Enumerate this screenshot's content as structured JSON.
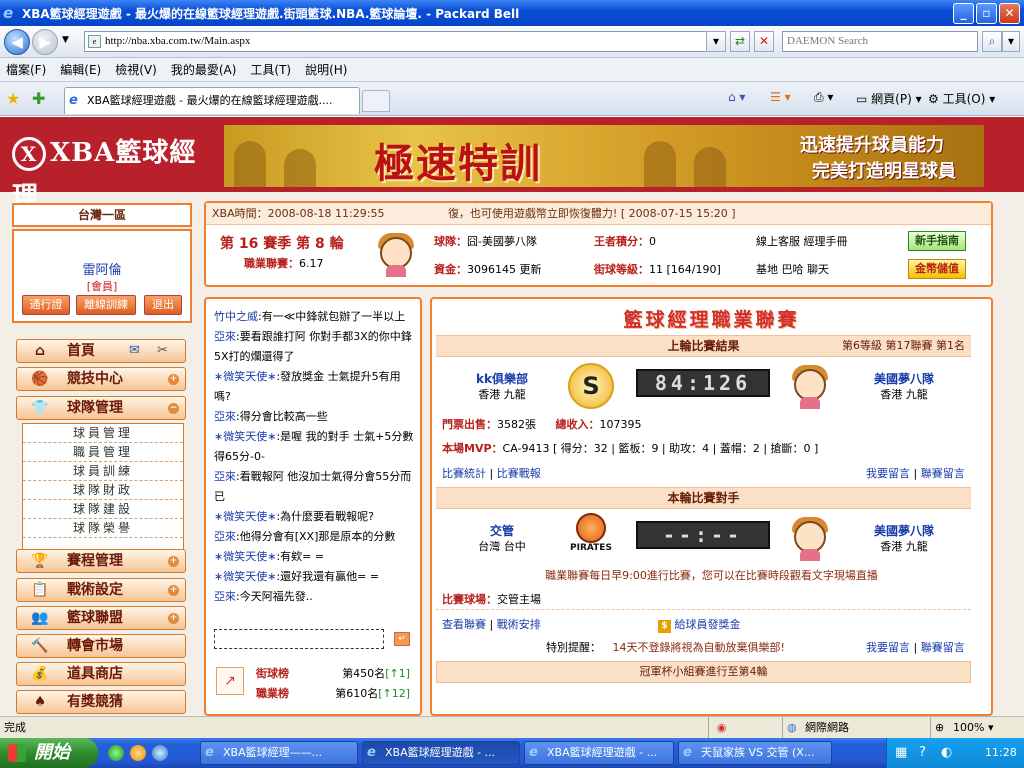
{
  "window": {
    "title": "XBA籃球經理遊戲 - 最火爆的在線籃球經理遊戲.街頭籃球.NBA.籃球論壇. - Packard Bell",
    "min": "_",
    "max": "▫",
    "close": "✕"
  },
  "address": {
    "url": "http://nba.xba.com.tw/Main.aspx",
    "search_placeholder": "DAEMON Search"
  },
  "menu": [
    "檔案(F)",
    "編輯(E)",
    "檢視(V)",
    "我的最愛(A)",
    "工具(T)",
    "說明(H)"
  ],
  "tab": {
    "label": "XBA籃球經理遊戲 - 最火爆的在線籃球經理遊戲....",
    "tools_page": "網頁(P)",
    "tools_tools": "工具(O)"
  },
  "banner": {
    "logo_text": "XBA籃球經理",
    "ad_main": "極速特訓",
    "ad_line1": "迅速提升球員能力",
    "ad_line2": "完美打造明星球員"
  },
  "sidebar": {
    "zone": "台灣一區",
    "user_name": "雷阿倫",
    "user_rank": "[會員]",
    "btn_pass": "通行證",
    "btn_train": "離線訓練",
    "btn_exit": "退出",
    "home": "首頁",
    "items": [
      {
        "label": "競技中心",
        "icon": "🏀",
        "toggle": "+"
      },
      {
        "label": "球隊管理",
        "icon": "👕",
        "toggle": "−"
      },
      {
        "label": "賽程管理",
        "icon": "🏆",
        "toggle": "+"
      },
      {
        "label": "戰術設定",
        "icon": "📋",
        "toggle": "+"
      },
      {
        "label": "籃球聯盟",
        "icon": "👥",
        "toggle": "+"
      },
      {
        "label": "轉會市場",
        "icon": "🔨",
        "toggle": ""
      },
      {
        "label": "道具商店",
        "icon": "💰",
        "toggle": ""
      },
      {
        "label": "有獎競猜",
        "icon": "♠",
        "toggle": ""
      }
    ],
    "sub_items": [
      "球員管理",
      "職員管理",
      "球員訓練",
      "球隊財政",
      "球隊建設",
      "球隊榮譽"
    ]
  },
  "info": {
    "time_label": "XBA時間：",
    "time": "2008-08-18 11:29:55",
    "notice": "復，也可使用遊戲幣立即恢復體力!",
    "notice_date": "[ 2008-07-15 15:20 ]",
    "season": "第 16 賽季 第 8 輪",
    "league_score_label": "職業聯賽：",
    "league_score": "6.17",
    "team_label": "球隊：",
    "team": "囧-美國夢八隊",
    "king_label": "王者積分：",
    "king": "0",
    "service": "線上客服",
    "manual": "經理手冊",
    "fund_label": "資金：",
    "fund": "3096145",
    "refresh": "更新",
    "level_label": "街球等級：",
    "level": "11 [164/190]",
    "base": "基地",
    "bar": "巴哈",
    "chat": "聊天",
    "btn_guide": "新手指南",
    "btn_coin": "金幣儲值"
  },
  "chat": {
    "lines": [
      {
        "who": "竹中之威",
        "msg": ":有一≪中鋒就包辦了一半以上"
      },
      {
        "who": "亞來",
        "msg": ":要看跟誰打阿 你對手都3X的你中鋒5X打的爛還得了"
      },
      {
        "who": "∗微笑天使∗",
        "msg": ":發放獎金 士氣提升5有用嗎?"
      },
      {
        "who": "亞來",
        "msg": ":得分會比較高一些"
      },
      {
        "who": "∗微笑天使∗",
        "msg": ":是喔 我的對手 士氣+5分數得65分-0-"
      },
      {
        "who": "亞來",
        "msg": ":看戰報阿 他沒加士氣得分會55分而已"
      },
      {
        "who": "∗微笑天使∗",
        "msg": ":為什麼要看戰報呢?"
      },
      {
        "who": "亞來",
        "msg": ":他得分會有[XX]那是原本的分數"
      },
      {
        "who": "∗微笑天使∗",
        "msg": ":有欸= ="
      },
      {
        "who": "∗微笑天使∗",
        "msg": ":還好我還有贏他= ="
      },
      {
        "who": "亞來",
        "msg": ":今天阿福先發.."
      }
    ],
    "rank1_label": "街球榜",
    "rank1_value": "第450名",
    "rank1_change": "[↑1]",
    "rank2_label": "職業榜",
    "rank2_value": "第610名",
    "rank2_change": "[↑12]"
  },
  "league": {
    "title": "籃球經理職業聯賽",
    "last_title": "上輪比賽結果",
    "last_meta": "第6等級 第17聯賽 第1名",
    "home_team": "kk俱樂部",
    "home_loc": "香港 九龍",
    "score": "84:126",
    "away_team": "美國夢八隊",
    "away_loc": "香港 九龍",
    "ticket_label": "門票出售：",
    "ticket": "3582張",
    "income_label": "總收入：",
    "income": "107395",
    "mvp_label": "本場MVP：",
    "mvp": "CA-9413 [ 得分：32 | 籃板：9 | 助攻：4 | 蓋帽：2 | 搶斷：0 ]",
    "stats_link": "比賽統計",
    "report_link": "比賽戰報",
    "msg_link": "我要留言",
    "lgmsg_link": "聯賽留言",
    "next_title": "本輪比賽對手",
    "opp_team": "交管",
    "opp_loc": "台灣 台中",
    "opp_emblem": "PIRATES",
    "next_score": "--:--",
    "away2_team": "美國夢八隊",
    "away2_loc": "香港 九龍",
    "schedule_note": "職業聯賽每日早9:00進行比賽，您可以在比賽時段觀看文字現場直播",
    "venue_label": "比賽球場：",
    "venue": "交管主場",
    "check_link": "查看聯賽",
    "tactic_link": "戰術安排",
    "bonus_link": "給球員發獎金",
    "warn_label": "特別提醒：",
    "warn": "14天不登錄將視為自動放棄俱樂部!",
    "msg2_link": "我要留言",
    "lgmsg2_link": "聯賽留言",
    "cup_note": "冠軍杯小組賽進行至第4輪"
  },
  "status": {
    "done": "完成",
    "zone": "網際網路",
    "zoom": "100%"
  },
  "taskbar": {
    "start": "開始",
    "tasks": [
      "XBA籃球經理——...",
      "XBA籃球經理遊戲 - ...",
      "XBA籃球經理遊戲 - ...",
      "天鼠家族 VS 交管 (X..."
    ],
    "clock": "11:28"
  }
}
